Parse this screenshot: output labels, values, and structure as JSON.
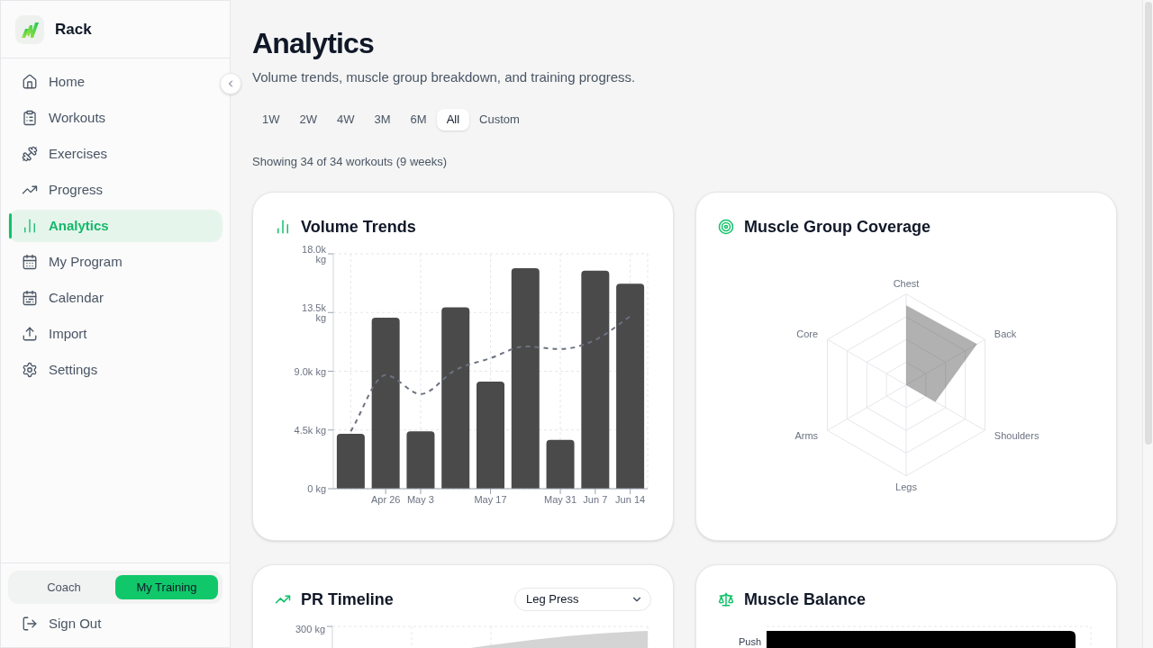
{
  "sidebar": {
    "brand": "Rack",
    "nav_items": [
      {
        "label": "Home",
        "selected": false
      },
      {
        "label": "Workouts",
        "selected": false
      },
      {
        "label": "Exercises",
        "selected": false
      },
      {
        "label": "Progress",
        "selected": false
      },
      {
        "label": "Analytics",
        "selected": true
      },
      {
        "label": "My Program",
        "selected": false
      },
      {
        "label": "Calendar",
        "selected": false
      },
      {
        "label": "Import",
        "selected": false
      },
      {
        "label": "Settings",
        "selected": false
      }
    ],
    "mode_toggle": [
      {
        "label": "Coach",
        "selected": false
      },
      {
        "label": "My Training",
        "selected": true
      }
    ],
    "sign_out": "Sign Out"
  },
  "page": {
    "title": "Analytics",
    "subtitle": "Volume trends, muscle group breakdown, and training progress."
  },
  "range_tabs": [
    {
      "label": "1W",
      "selected": false
    },
    {
      "label": "2W",
      "selected": false
    },
    {
      "label": "4W",
      "selected": false
    },
    {
      "label": "3M",
      "selected": false
    },
    {
      "label": "6M",
      "selected": false
    },
    {
      "label": "All",
      "selected": true
    },
    {
      "label": "Custom",
      "selected": false
    }
  ],
  "summary": "Showing 34 of 34 workouts (9 weeks)",
  "volume_trends": {
    "title": "Volume Trends",
    "chart_data": {
      "type": "bar",
      "categories": [
        null,
        "Apr 26",
        "May 3",
        null,
        "May 17",
        null,
        "May 31",
        "Jun 7",
        "Jun 14"
      ],
      "ylim": [
        0,
        18000
      ],
      "yticks": [
        {
          "value": 0,
          "label": "0 kg"
        },
        {
          "value": 4500,
          "label": "4.5k kg"
        },
        {
          "value": 9000,
          "label": "9.0k kg"
        },
        {
          "value": 13500,
          "label": "13.5k kg"
        },
        {
          "value": 18000,
          "label": "18.0k kg"
        }
      ],
      "grid": true,
      "series": [
        {
          "type": "bar",
          "color": "#4a4a4a",
          "values": [
            4200,
            13100,
            4400,
            13900,
            8200,
            16900,
            3750,
            16700,
            15700
          ]
        },
        {
          "type": "line",
          "color": "#6b7280",
          "line_style": "dashed",
          "values": [
            4400,
            8700,
            7250,
            9100,
            10000,
            10900,
            10700,
            11400,
            13200
          ]
        }
      ]
    }
  },
  "muscle_group_coverage": {
    "title": "Muscle Group Coverage",
    "axes": [
      "Chest",
      "Back",
      "Shoulders",
      "Legs",
      "Arms",
      "Core"
    ]
  },
  "pr_timeline": {
    "title": "PR Timeline",
    "exercise_select": {
      "value": "Leg Press"
    },
    "y_tick_labels": [
      "300 kg"
    ]
  },
  "muscle_balance": {
    "title": "Muscle Balance",
    "rows": [
      {
        "label": "Push"
      }
    ]
  }
}
